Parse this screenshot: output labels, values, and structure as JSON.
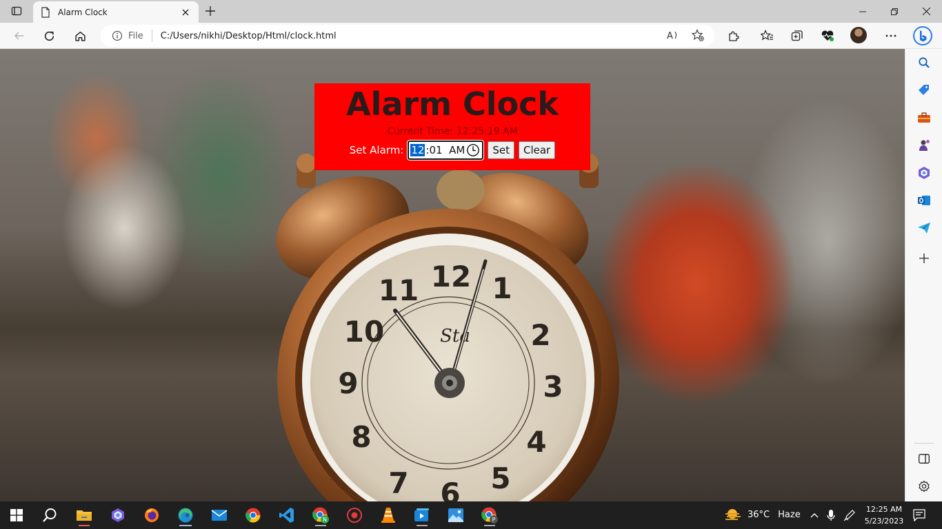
{
  "browser": {
    "tab_title": "Alarm Clock",
    "address_scheme": "File",
    "address_url": "C:/Users/nikhi/Desktop/Html/clock.html"
  },
  "page": {
    "heading": "Alarm Clock",
    "current_time_label": "Current Time: 12:25:19 AM",
    "set_alarm_label": "Set Alarm:",
    "alarm_hour": "12",
    "alarm_rest": ":01  AM",
    "set_button": "Set",
    "clear_button": "Clear"
  },
  "taskbar": {
    "weather_temp": "36°C",
    "weather_desc": "Haze",
    "time": "12:25 AM",
    "date": "5/23/2023"
  },
  "colors": {
    "panel_bg": "#ff0000",
    "heading": "#2a1a1a",
    "taskbar": "#1f1f1f",
    "selection": "#0066cc"
  },
  "icons": {
    "sidebar": [
      "search-icon",
      "tag-icon",
      "briefcase-icon",
      "games-icon",
      "office-icon",
      "outlook-icon",
      "send-icon",
      "add-icon",
      "split-screen-icon",
      "settings-icon"
    ],
    "taskbar": [
      "windows-start-icon",
      "search-icon",
      "file-explorer-icon",
      "visual-studio-icon",
      "firefox-icon",
      "edge-icon",
      "mail-icon",
      "chrome-icon",
      "vscode-icon",
      "chrome-profile-n-icon",
      "record-icon",
      "vlc-icon",
      "media-player-icon",
      "photos-icon",
      "chrome-profile-p-icon"
    ]
  }
}
